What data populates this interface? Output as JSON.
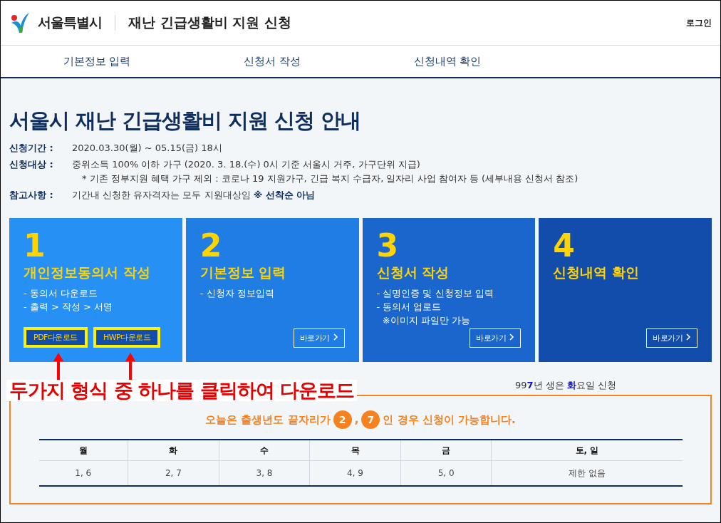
{
  "header": {
    "brand": "서울특별시",
    "title": "재난 긴급생활비 지원 신청",
    "login": "로그인"
  },
  "nav": [
    {
      "label": "기본정보 입력",
      "selected": false
    },
    {
      "label": "신청서 작성",
      "selected": false
    },
    {
      "label": "신청내역 확인",
      "selected": false
    }
  ],
  "heading": "서울시 재난 긴급생활비 지원 신청 안내",
  "info": [
    {
      "label": "신청기간 :",
      "lines": [
        "2020.03.30(월) ~ 05.15(금) 18시"
      ]
    },
    {
      "label": "신청대상 :",
      "lines": [
        "중위소득 100% 이하 가구 (2020. 3. 18.(수) 0시 기준 서울시 거주, 가구단위 지급)",
        "* 기존 정부지원 혜택 가구 제외 : 코로나 19 지원가구, 긴급 복지 수급자, 일자리 사업 참여자 등 (세부내용 신청서 참조)"
      ]
    },
    {
      "label": "참고사항 :",
      "lines": [
        "기간내 신청한 유자격자는 모두 지원대상임 **※ 선착순 아님**"
      ]
    }
  ],
  "steps": [
    {
      "number": "1",
      "title": "개인정보동의서 작성",
      "lines": [
        "- 동의서 다운로드",
        "- 출력 > 작성 > 서명"
      ],
      "buttons": [
        {
          "label": "PDF다운로드",
          "kind": "download",
          "highlighted": true
        },
        {
          "label": "HWP다운로드",
          "kind": "download",
          "highlighted": true
        }
      ],
      "color": "#2690f4"
    },
    {
      "number": "2",
      "title": "기본정보 입력",
      "lines": [
        "- 신청자 정보입력"
      ],
      "buttons": [
        {
          "label": "바로가기",
          "kind": "go",
          "highlighted": false
        }
      ],
      "color": "#1f7de4"
    },
    {
      "number": "3",
      "title": "신청서 작성",
      "lines": [
        "- 실명인증 및 신청정보 입력",
        "- 동의서 업로드",
        "  ※이미지 파일만 가능"
      ],
      "buttons": [
        {
          "label": "바로가기",
          "kind": "go",
          "highlighted": false
        }
      ],
      "color": "#1a66cc"
    },
    {
      "number": "4",
      "title": "신청내역 확인",
      "buttons": [
        {
          "label": "바로가기",
          "kind": "go",
          "highlighted": false
        }
      ],
      "color": "#124dab"
    }
  ],
  "notice": "99**7**년 생은 **화**요일 신청",
  "annotation": "두가지 형식 중 하나를 클릭하여 다운로드",
  "today": {
    "before": "오늘은 출생년도 끝자리가",
    "digits": [
      "2",
      "7"
    ],
    "separator": ",",
    "after": "인 경우 신청이 가능합니다."
  },
  "table": {
    "columns": [
      "월",
      "화",
      "수",
      "목",
      "금",
      "토, 일"
    ],
    "rows": [
      [
        "1, 6",
        "2, 7",
        "3, 8",
        "4, 9",
        "5, 0",
        "제한 없음"
      ]
    ]
  }
}
